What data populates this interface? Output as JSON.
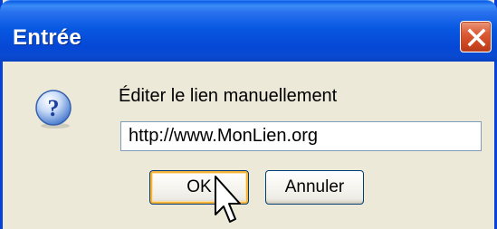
{
  "dialog": {
    "title": "Entrée",
    "prompt": "Éditer le lien manuellement",
    "url_value": "http://www.MonLien.org",
    "ok_label": "OK",
    "cancel_label": "Annuler"
  },
  "icons": {
    "close": "close-icon",
    "question": "question-icon",
    "cursor": "mouse-cursor-icon"
  },
  "colors": {
    "titlebar": "#0858e2",
    "close_button": "#dc5a36",
    "dialog_background": "#ece9d8",
    "default_button_focus": "#f8b33a"
  }
}
